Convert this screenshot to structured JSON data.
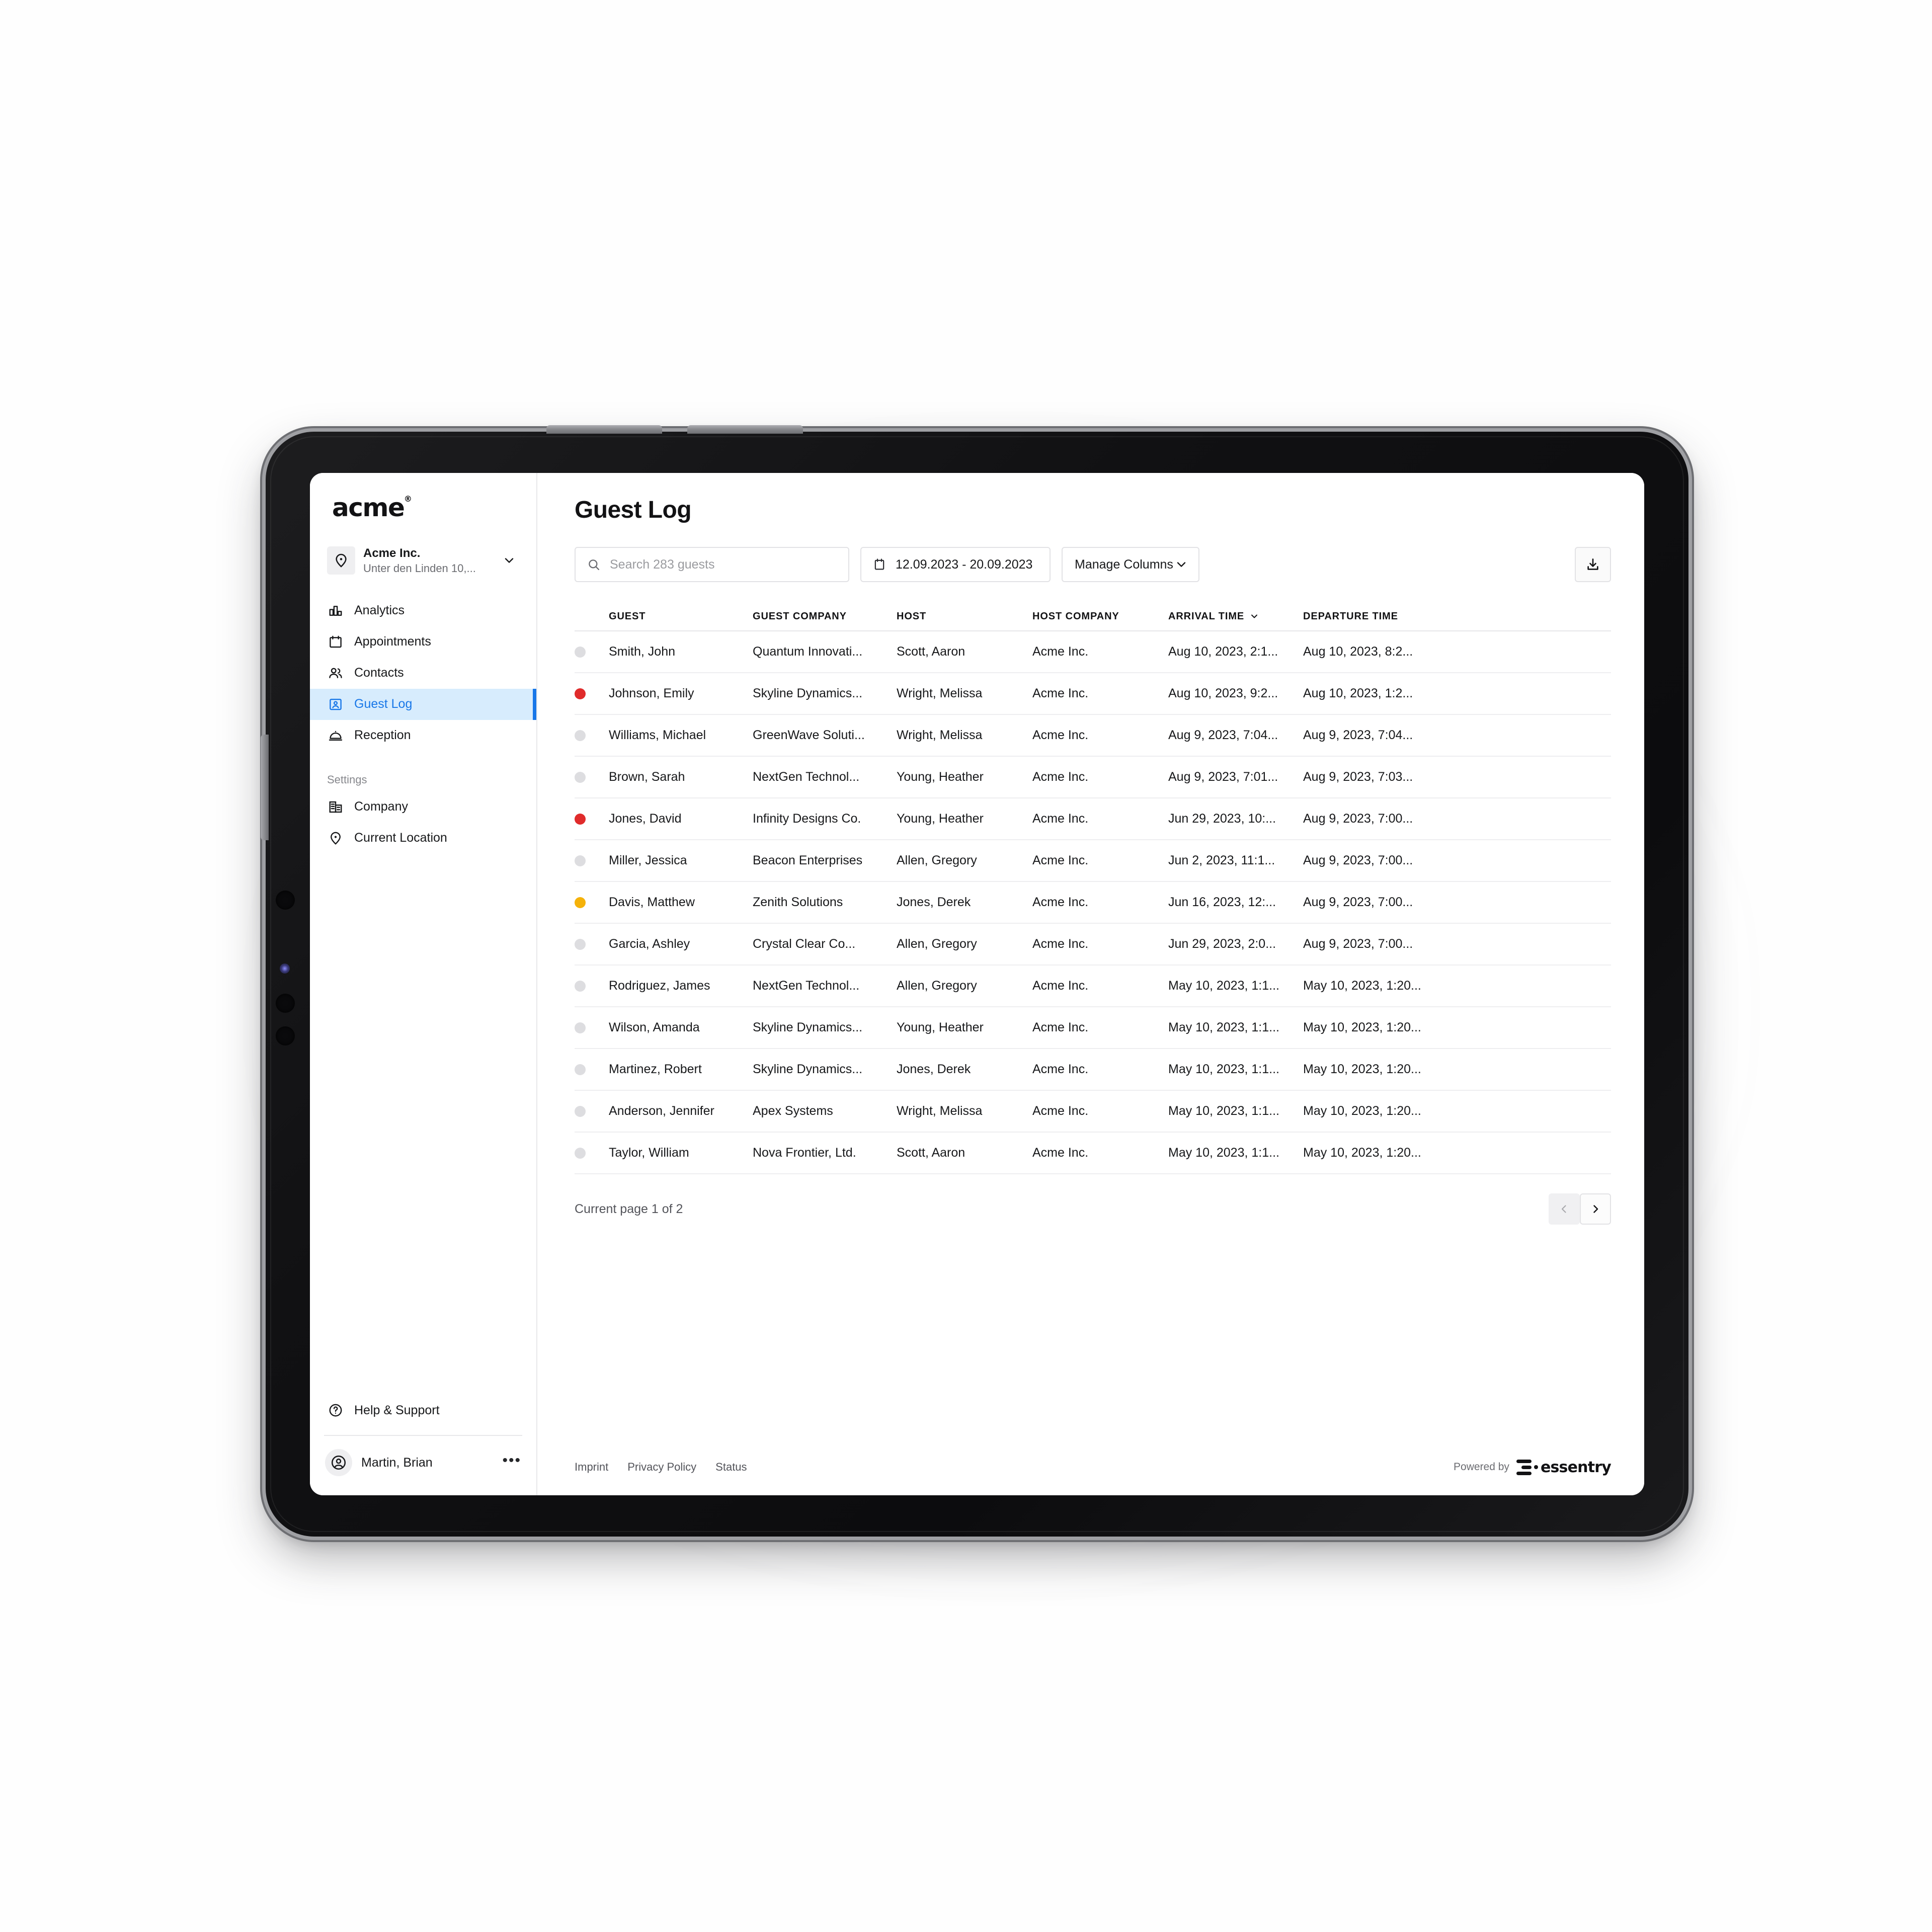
{
  "brand": {
    "logo_text": "acme",
    "registered_mark": "®"
  },
  "org": {
    "name": "Acme Inc.",
    "address": "Unter den Linden 10,...",
    "location_icon": "map-pin-icon",
    "chevron_icon": "chevron-down-icon"
  },
  "sidebar": {
    "primary_items": [
      {
        "label": "Analytics",
        "icon": "bar-chart-icon",
        "active": false
      },
      {
        "label": "Appointments",
        "icon": "calendar-icon",
        "active": false
      },
      {
        "label": "Contacts",
        "icon": "users-icon",
        "active": false
      },
      {
        "label": "Guest Log",
        "icon": "id-badge-icon",
        "active": true
      },
      {
        "label": "Reception",
        "icon": "room-service-icon",
        "active": false
      }
    ],
    "section_label": "Settings",
    "settings_items": [
      {
        "label": "Company",
        "icon": "building-icon"
      },
      {
        "label": "Current Location",
        "icon": "map-pin-icon"
      }
    ],
    "help": {
      "label": "Help & Support",
      "icon": "question-circle-icon"
    },
    "user": {
      "name": "Martin, Brian",
      "avatar_icon": "user-circle-icon",
      "more_icon": "ellipsis-icon"
    }
  },
  "header": {
    "title": "Guest Log"
  },
  "toolbar": {
    "search": {
      "placeholder": "Search 283 guests",
      "value": "",
      "icon": "search-icon"
    },
    "date_range": {
      "value": "12.09.2023 - 20.09.2023",
      "icon": "calendar-icon"
    },
    "manage_columns": {
      "label": "Manage Columns",
      "icon": "chevron-down-icon"
    },
    "download": {
      "icon": "download-icon"
    }
  },
  "table": {
    "columns": [
      {
        "key": "status",
        "label": ""
      },
      {
        "key": "guest",
        "label": "GUEST"
      },
      {
        "key": "gcompany",
        "label": "GUEST COMPANY"
      },
      {
        "key": "host",
        "label": "HOST"
      },
      {
        "key": "hcompany",
        "label": "HOST COMPANY"
      },
      {
        "key": "arrival",
        "label": "ARRIVAL TIME",
        "sort_icon": "chevron-down-icon"
      },
      {
        "key": "departure",
        "label": "DEPARTURE TIME"
      }
    ],
    "rows": [
      {
        "status": "grey",
        "guest": "Smith, John",
        "gcompany": "Quantum Innovati...",
        "host": "Scott, Aaron",
        "hcompany": "Acme Inc.",
        "arrival": "Aug 10, 2023, 2:1...",
        "departure": "Aug 10, 2023, 8:2..."
      },
      {
        "status": "red",
        "guest": "Johnson, Emily",
        "gcompany": "Skyline Dynamics...",
        "host": "Wright, Melissa",
        "hcompany": "Acme Inc.",
        "arrival": "Aug 10, 2023, 9:2...",
        "departure": "Aug 10, 2023, 1:2..."
      },
      {
        "status": "grey",
        "guest": "Williams, Michael",
        "gcompany": "GreenWave Soluti...",
        "host": "Wright, Melissa",
        "hcompany": "Acme Inc.",
        "arrival": "Aug 9, 2023, 7:04...",
        "departure": "Aug 9, 2023, 7:04..."
      },
      {
        "status": "grey",
        "guest": "Brown, Sarah",
        "gcompany": "NextGen Technol...",
        "host": "Young, Heather",
        "hcompany": "Acme Inc.",
        "arrival": "Aug 9, 2023, 7:01...",
        "departure": "Aug 9, 2023, 7:03..."
      },
      {
        "status": "red",
        "guest": "Jones, David",
        "gcompany": "Infinity Designs Co.",
        "host": "Young, Heather",
        "hcompany": "Acme Inc.",
        "arrival": "Jun 29, 2023, 10:...",
        "departure": "Aug 9, 2023, 7:00..."
      },
      {
        "status": "grey",
        "guest": "Miller, Jessica",
        "gcompany": "Beacon Enterprises",
        "host": "Allen, Gregory",
        "hcompany": "Acme Inc.",
        "arrival": "Jun 2, 2023, 11:1...",
        "departure": "Aug 9, 2023, 7:00..."
      },
      {
        "status": "yellow",
        "guest": "Davis, Matthew",
        "gcompany": "Zenith Solutions",
        "host": "Jones, Derek",
        "hcompany": "Acme Inc.",
        "arrival": "Jun 16, 2023, 12:...",
        "departure": "Aug 9, 2023, 7:00..."
      },
      {
        "status": "grey",
        "guest": "Garcia, Ashley",
        "gcompany": "Crystal Clear Co...",
        "host": "Allen, Gregory",
        "hcompany": "Acme Inc.",
        "arrival": "Jun 29, 2023, 2:0...",
        "departure": "Aug 9, 2023, 7:00..."
      },
      {
        "status": "grey",
        "guest": "Rodriguez, James",
        "gcompany": "NextGen Technol...",
        "host": "Allen, Gregory",
        "hcompany": "Acme Inc.",
        "arrival": "May 10, 2023, 1:1...",
        "departure": "May 10, 2023, 1:20..."
      },
      {
        "status": "grey",
        "guest": "Wilson, Amanda",
        "gcompany": "Skyline Dynamics...",
        "host": "Young, Heather",
        "hcompany": "Acme Inc.",
        "arrival": "May 10, 2023, 1:1...",
        "departure": "May 10, 2023, 1:20..."
      },
      {
        "status": "grey",
        "guest": "Martinez, Robert",
        "gcompany": "Skyline Dynamics...",
        "host": "Jones, Derek",
        "hcompany": "Acme Inc.",
        "arrival": "May 10, 2023, 1:1...",
        "departure": "May 10, 2023, 1:20..."
      },
      {
        "status": "grey",
        "guest": "Anderson, Jennifer",
        "gcompany": "Apex Systems",
        "host": "Wright, Melissa",
        "hcompany": "Acme Inc.",
        "arrival": "May 10, 2023, 1:1...",
        "departure": "May 10, 2023, 1:20..."
      },
      {
        "status": "grey",
        "guest": "Taylor, William",
        "gcompany": "Nova Frontier, Ltd.",
        "host": "Scott, Aaron",
        "hcompany": "Acme Inc.",
        "arrival": "May 10, 2023, 1:1...",
        "departure": "May 10, 2023, 1:20..."
      }
    ]
  },
  "pagination": {
    "status_text": "Current page 1 of 2",
    "prev_icon": "chevron-left-icon",
    "next_icon": "chevron-right-icon"
  },
  "footer": {
    "links": [
      "Imprint",
      "Privacy Policy",
      "Status"
    ],
    "powered_by_label": "Powered by",
    "powered_by_brand": "essentry"
  },
  "colors": {
    "accent": "#1877e8",
    "accent_bg": "#d7ecfd",
    "status_red": "#e02b2b",
    "status_yellow": "#f5b20a",
    "status_grey": "#dddde0"
  }
}
